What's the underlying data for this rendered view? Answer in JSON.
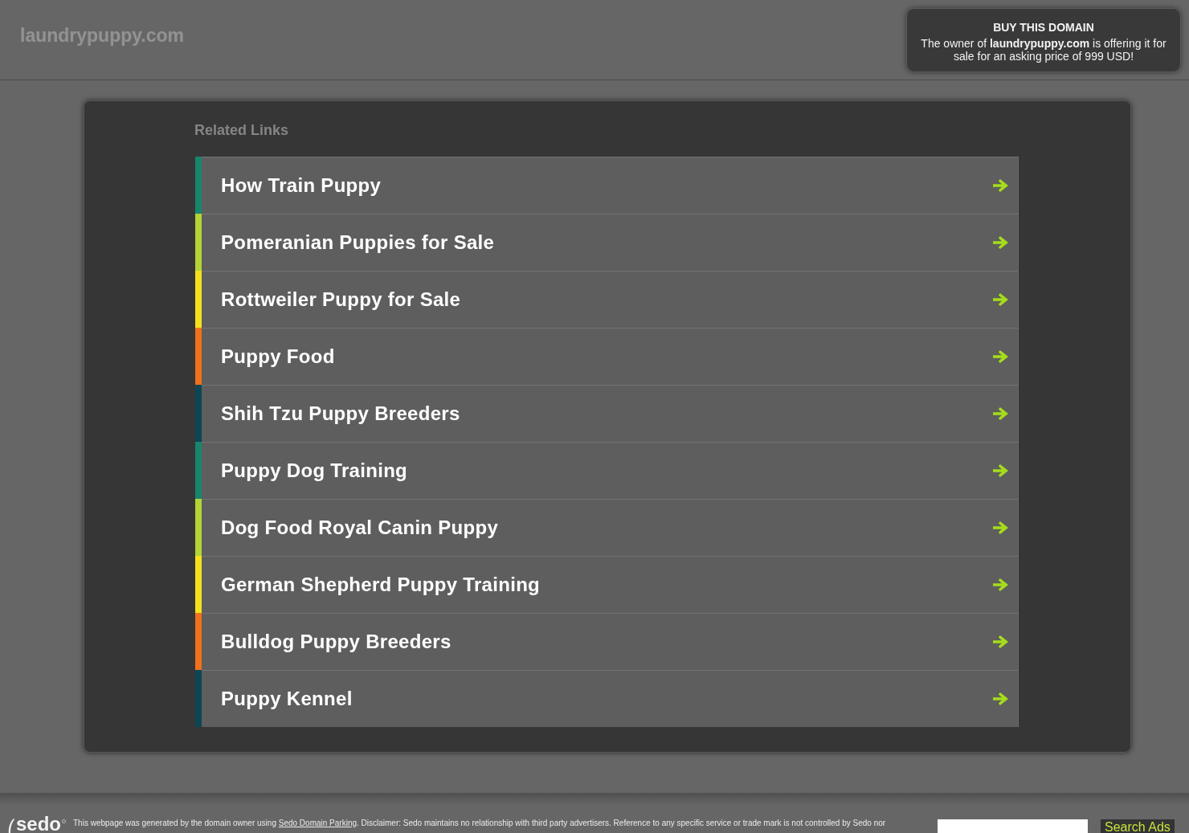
{
  "header": {
    "domain": "laundrypuppy.com"
  },
  "buy_box": {
    "title": "BUY THIS DOMAIN",
    "text": "The owner of **laundrypuppy.com** is offering it for sale for an asking price of 999 USD!"
  },
  "related_links": {
    "title": "Related Links",
    "items": [
      {
        "label": "How Train Puppy",
        "color": "#16866c"
      },
      {
        "label": "Pomeranian Puppies for Sale",
        "color": "#b4d335"
      },
      {
        "label": "Rottweiler Puppy for Sale",
        "color": "#f4e11c"
      },
      {
        "label": "Puppy Food",
        "color": "#f0701b"
      },
      {
        "label": "Shih Tzu Puppy Breeders",
        "color": "#0c4655"
      },
      {
        "label": "Puppy Dog Training",
        "color": "#16866c"
      },
      {
        "label": "Dog Food Royal Canin Puppy",
        "color": "#b4d335"
      },
      {
        "label": "German Shepherd Puppy Training",
        "color": "#f4e11c"
      },
      {
        "label": "Bulldog Puppy Breeders",
        "color": "#f0701b"
      },
      {
        "label": "Puppy Kennel",
        "color": "#0c4655"
      }
    ]
  },
  "footer": {
    "logo": "sedo",
    "disclaimer": {
      "text_before": "This webpage was generated by the domain owner using ",
      "link": "Sedo Domain Parking",
      "text_after": ". Disclaimer: Sedo maintains no relationship with third party advertisers. Reference to any specific service or trade mark is not controlled by Sedo nor"
    },
    "search_button": "Search Ads"
  }
}
